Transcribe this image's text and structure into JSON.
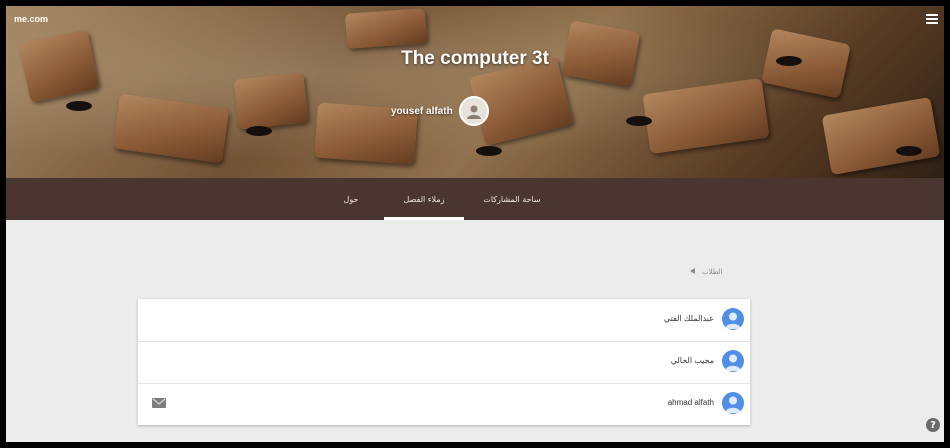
{
  "header": {
    "site_mark": "me.com",
    "menu_icon": "hamburger-menu-icon",
    "class_title": "The computer 3t",
    "teacher_name": "yousef alfath",
    "teacher_avatar_icon": "teacher-avatar-icon"
  },
  "tabs": [
    {
      "label": "ساحة المشاركات",
      "active": false
    },
    {
      "label": "زملاء الفصل",
      "active": true
    },
    {
      "label": "حول",
      "active": false
    }
  ],
  "sort": {
    "label": "الطلاب",
    "icon": "sort-arrow-icon"
  },
  "students": [
    {
      "name": "عبدالملك الفتي",
      "avatar_icon": "person-avatar-icon",
      "has_mail": false
    },
    {
      "name": "مجيب الحالي",
      "avatar_icon": "person-avatar-icon",
      "has_mail": false
    },
    {
      "name": "ahmad alfath",
      "avatar_icon": "person-avatar-icon",
      "has_mail": true
    }
  ],
  "help": {
    "label": "?",
    "icon": "help-icon"
  },
  "colors": {
    "tab_bar": "#4a3531",
    "avatar_blue": "#4f8fe6",
    "page_background": "#ececec"
  }
}
